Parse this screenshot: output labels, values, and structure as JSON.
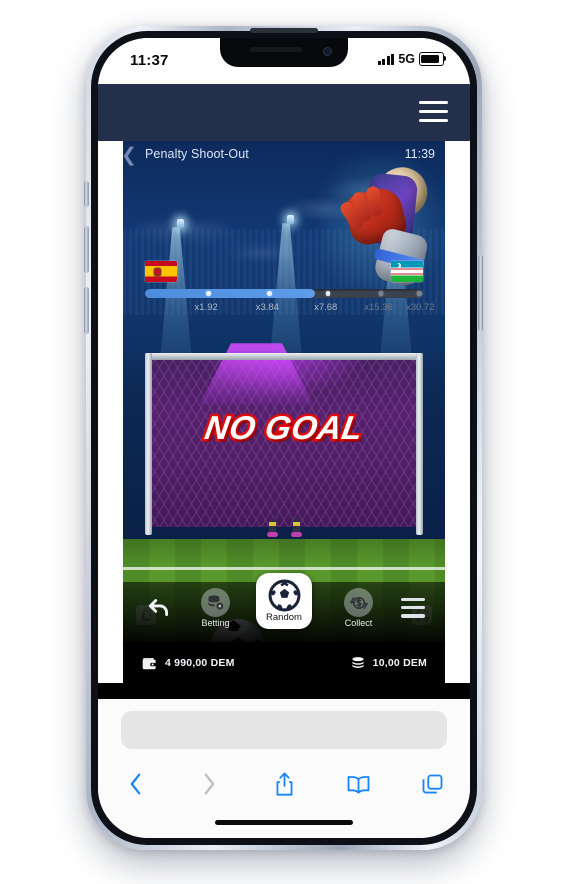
{
  "status_bar": {
    "time": "11:37",
    "network": "5G",
    "signal_icon": "cellular-bars-icon",
    "battery_icon": "battery-full-icon"
  },
  "site_header": {
    "menu_icon": "hamburger-menu-icon"
  },
  "game": {
    "title": "Penalty Shoot-Out",
    "clock": "11:39",
    "back_icon": "back-chevron-icon",
    "result_banner": "NO GOAL",
    "teams": {
      "home_flag": "spain-flag-icon",
      "away_flag": "uzbekistan-flag-icon"
    },
    "multipliers": [
      {
        "label": "x1.92",
        "reached": true
      },
      {
        "label": "x3.84",
        "reached": true
      },
      {
        "label": "x7.68",
        "reached": true
      },
      {
        "label": "x15.36",
        "reached": false
      },
      {
        "label": "x30.72",
        "reached": false
      }
    ],
    "overlay_icons": {
      "paytable": "paytable-icon",
      "fullscreen": "fullscreen-icon"
    },
    "controls": {
      "undo_icon": "undo-arrow-icon",
      "betting_label": "Betting",
      "betting_icon": "coins-gear-icon",
      "random_label": "Random",
      "random_icon": "soccer-ball-icon",
      "collect_label": "Collect",
      "collect_icon": "dollar-refresh-icon",
      "menu_icon": "menu-lines-icon"
    },
    "balance": {
      "wallet_icon": "wallet-icon",
      "wallet_amount": "4 990,00 DEM",
      "bet_icon": "coin-stack-icon",
      "bet_amount": "10,00 DEM"
    },
    "accent_colors": {
      "header": "#232f4b",
      "progress_fill": "#4d8ddd",
      "banner_outline": "#e00c0c",
      "pitch": "#54942b"
    }
  },
  "browser": {
    "url_value": "",
    "url_placeholder": "",
    "back_icon": "chevron-left-icon",
    "forward_icon": "chevron-right-icon",
    "share_icon": "share-icon",
    "bookmarks_icon": "book-icon",
    "tabs_icon": "tabs-icon"
  }
}
